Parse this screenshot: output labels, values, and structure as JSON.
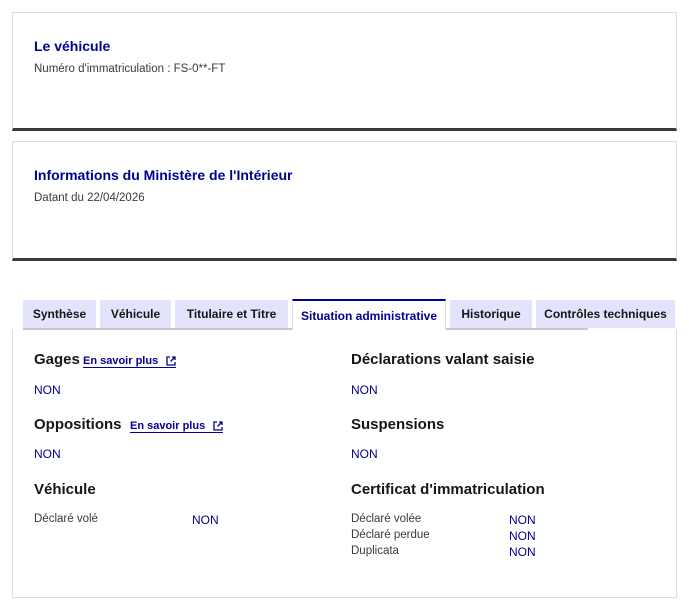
{
  "vehicle_card": {
    "title": "Le véhicule",
    "subtitle": "Numéro d'immatriculation : FS-0**-FT"
  },
  "ministry_card": {
    "title": "Informations du Ministère de l'Intérieur",
    "subtitle": "Datant du 22/04/2026"
  },
  "tabs": [
    {
      "label": "Synthèse",
      "active": false
    },
    {
      "label": "Véhicule",
      "active": false
    },
    {
      "label": "Titulaire et Titre",
      "active": false
    },
    {
      "label": "Situation administrative",
      "active": true
    },
    {
      "label": "Historique",
      "active": false
    },
    {
      "label": "Contrôles techniques",
      "active": false
    }
  ],
  "colors": {
    "accent": "#000091",
    "tab_bg": "#e3e3fd",
    "divider": "#3a3a3a"
  },
  "sections": {
    "gages": {
      "title": "Gages",
      "link": "En savoir plus",
      "link_icon": "external-link-icon",
      "value": "NON"
    },
    "saisie": {
      "title": "Déclarations valant saisie",
      "value": "NON"
    },
    "oppositions": {
      "title": "Oppositions",
      "link": "En savoir plus",
      "link_icon": "external-link-icon",
      "value": "NON"
    },
    "suspensions": {
      "title": "Suspensions",
      "value": "NON"
    },
    "vehicule": {
      "title": "Véhicule",
      "rows": [
        {
          "label": "Déclaré volé",
          "value": "NON"
        }
      ]
    },
    "certificat": {
      "title": "Certificat d'immatriculation",
      "rows": [
        {
          "label": "Déclaré volée",
          "value": "NON"
        },
        {
          "label": "Déclaré perdue",
          "value": "NON"
        },
        {
          "label": "Duplicata",
          "value": "NON"
        }
      ]
    }
  }
}
